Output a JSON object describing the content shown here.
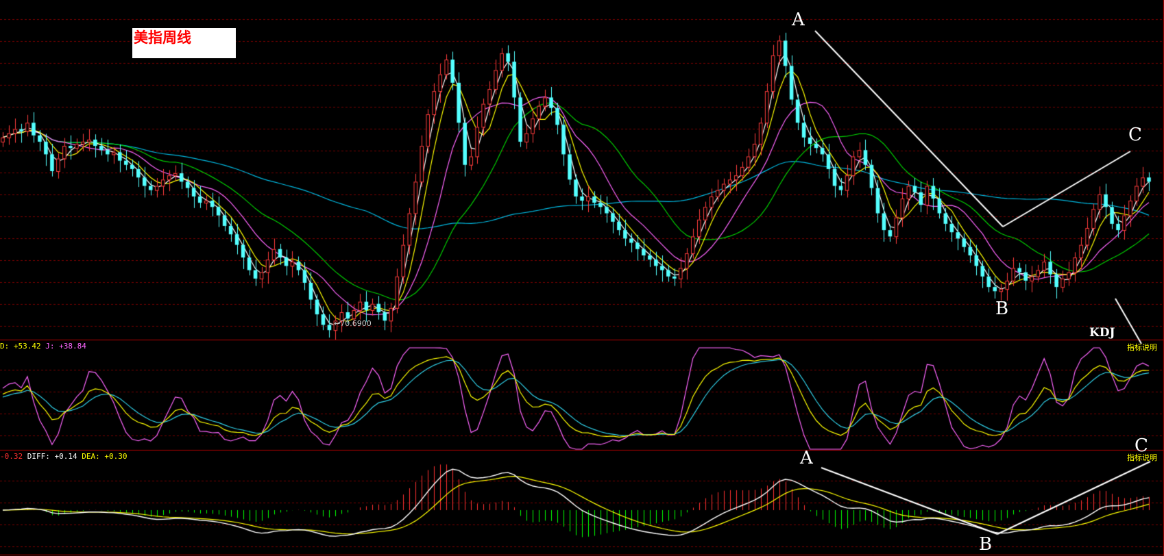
{
  "title": "美指周线",
  "colors": {
    "background": "#000000",
    "grid": "#7a0000",
    "up": "#ff3c3c",
    "down": "#54ffff",
    "ma1": "#ffffff",
    "ma2": "#ffff00",
    "ma3": "#ff66ff",
    "ma4": "#00d000",
    "ma5": "#00b8e0",
    "k": "#ffffff",
    "d": "#ffff00",
    "j": "#ff66ff",
    "kdj_d_line": "#30d0e8",
    "diff": "#ffffff",
    "dea": "#ffff00",
    "macd_up": "#ff3030",
    "macd_down": "#00ff00"
  },
  "kdj": {
    "name": "KDJ",
    "readout_d": "D: +53.42",
    "readout_j": "J: +38.84",
    "help": "指标说明"
  },
  "macd": {
    "readout_macd": "-0.32",
    "readout_diff": "DIFF: +0.14",
    "readout_dea": "DEA: +0.30",
    "help": "指标说明"
  },
  "min_label": "←70.6900",
  "annotations": {
    "price_A": "A",
    "price_B": "B",
    "price_C": "C",
    "kdj_label": "KDJ",
    "macd_A": "A",
    "macd_B": "B",
    "macd_C": "C"
  },
  "chart_data": {
    "type": "line",
    "ylim": [
      70.0,
      102.0
    ],
    "close": [
      89.2,
      89.6,
      90.0,
      89.8,
      90.6,
      89.4,
      88.8,
      87.6,
      86.0,
      87.2,
      88.4,
      88.2,
      88.6,
      88.8,
      89.0,
      88.4,
      88.0,
      87.6,
      87.8,
      87.0,
      86.6,
      86.2,
      85.4,
      84.6,
      84.2,
      84.6,
      85.2,
      85.6,
      85.8,
      85.0,
      84.4,
      83.6,
      83.0,
      83.2,
      82.6,
      81.8,
      80.8,
      80.0,
      79.0,
      77.8,
      76.6,
      75.8,
      76.4,
      77.6,
      78.6,
      77.8,
      77.0,
      77.4,
      76.6,
      75.4,
      73.8,
      72.4,
      71.4,
      70.9,
      71.8,
      72.6,
      72.0,
      72.8,
      73.6,
      72.8,
      73.4,
      72.6,
      71.8,
      73.0,
      76.0,
      79.0,
      82.0,
      85.0,
      88.4,
      91.4,
      93.6,
      95.2,
      96.6,
      94.4,
      90.6,
      86.6,
      87.4,
      90.2,
      92.4,
      93.8,
      95.6,
      97.2,
      96.4,
      93.0,
      88.8,
      89.6,
      91.0,
      92.2,
      93.0,
      92.0,
      90.4,
      87.6,
      85.2,
      83.6,
      83.2,
      83.6,
      83.0,
      82.6,
      82.0,
      81.2,
      80.4,
      79.6,
      79.2,
      78.6,
      78.0,
      77.6,
      77.0,
      76.6,
      76.0,
      75.8,
      76.8,
      78.2,
      79.8,
      81.4,
      82.6,
      83.6,
      84.2,
      84.8,
      85.2,
      85.6,
      86.4,
      87.4,
      88.6,
      90.6,
      93.6,
      97.0,
      98.4,
      96.0,
      92.8,
      90.6,
      89.2,
      88.6,
      88.2,
      87.6,
      86.2,
      84.6,
      84.2,
      85.6,
      87.4,
      88.0,
      86.6,
      84.4,
      82.0,
      80.4,
      79.8,
      81.6,
      83.4,
      84.6,
      84.0,
      82.8,
      84.6,
      83.4,
      82.0,
      81.0,
      80.2,
      79.6,
      78.8,
      78.0,
      77.0,
      76.0,
      75.0,
      74.6,
      74.8,
      75.6,
      76.8,
      76.4,
      75.6,
      76.0,
      76.6,
      77.4,
      76.2,
      75.0,
      75.8,
      76.4,
      77.8,
      79.0,
      80.6,
      82.4,
      83.8,
      82.6,
      81.0,
      80.4,
      81.8,
      83.2,
      84.6,
      85.4,
      85.0
    ]
  }
}
